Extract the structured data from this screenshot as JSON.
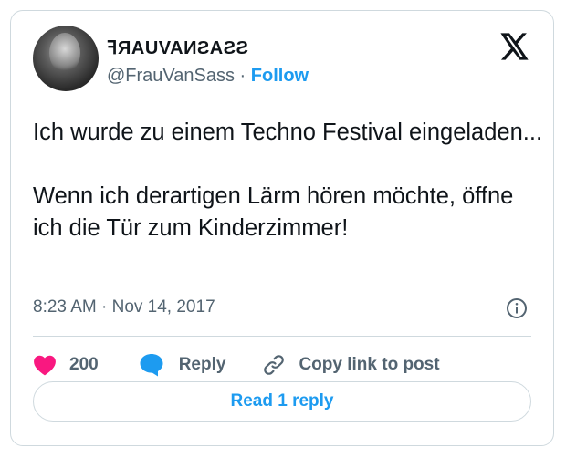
{
  "author": {
    "display_name": "ꟻЯAUVAИƧAƧƧ",
    "handle": "@FrauVanSass",
    "separator": " · ",
    "follow_label": "Follow"
  },
  "tweet": {
    "paragraphs": [
      "Ich wurde zu einem Techno Festival eingeladen...",
      "Wenn ich derartigen Lärm hören möchte, öffne ich die Tür zum Kinderzimmer!"
    ],
    "time": "8:23 AM",
    "separator": " · ",
    "date": "Nov 14, 2017"
  },
  "actions": {
    "like_count": "200",
    "reply_label": "Reply",
    "copy_link_label": "Copy link to post"
  },
  "read_replies_label": "Read 1 reply",
  "icons": {
    "like": "heart-icon",
    "reply": "speech-bubble-icon",
    "copy": "link-icon",
    "info": "info-icon",
    "logo": "x-logo-icon"
  },
  "colors": {
    "accent": "#1d9bf0",
    "like": "#f91880",
    "muted": "#536471",
    "text": "#0f1419",
    "border": "#cfd9de"
  }
}
